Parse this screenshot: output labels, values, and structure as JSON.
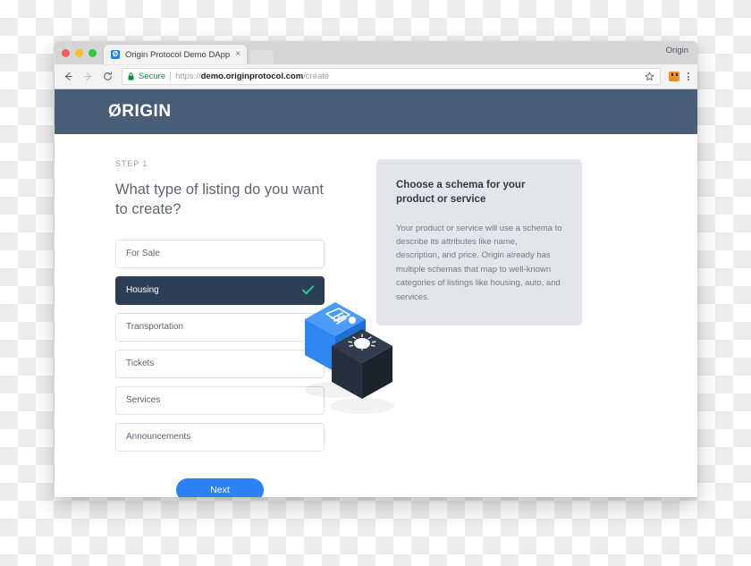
{
  "browser": {
    "traffic_lights": [
      "close",
      "minimize",
      "maximize"
    ],
    "tab": {
      "favicon_glyph": "Ø",
      "title": "Origin Protocol Demo DApp",
      "close_glyph": "×"
    },
    "profile_name": "Origin",
    "nav": {
      "back": "back-arrow",
      "forward": "forward-arrow",
      "reload": "reload-arrow"
    },
    "omnibox": {
      "lock_icon": "lock-icon",
      "secure_label": "Secure",
      "url_scheme": "https://",
      "url_host": "demo.originprotocol.com",
      "url_path": "/create",
      "star_icon": "star-icon",
      "extension_icon": "metamask-extension-icon",
      "menu_icon": "three-dot-menu-icon"
    }
  },
  "site": {
    "brand": "ØRIGIN"
  },
  "main": {
    "step_label": "STEP 1",
    "headline": "What type of listing do you want to create?",
    "options": [
      {
        "label": "For Sale",
        "selected": false
      },
      {
        "label": "Housing",
        "selected": true
      },
      {
        "label": "Transportation",
        "selected": false
      },
      {
        "label": "Tickets",
        "selected": false
      },
      {
        "label": "Services",
        "selected": false
      },
      {
        "label": "Announcements",
        "selected": false
      }
    ],
    "selected_option": "Housing",
    "next_label": "Next"
  },
  "info_panel": {
    "title": "Choose a schema for your product or service",
    "body": "Your product or service will use a schema to describe its attributes like name, description, and price. Origin already has multiple schemas that map to well-known categories of listings like housing, auto, and services."
  },
  "illustration": {
    "cube_blue_icon": "document-tag-icon",
    "cube_dark_icon": "lightbulb-icon"
  },
  "colors": {
    "header_navy": "#4a5d77",
    "selected_navy": "#2e3f55",
    "accent_blue": "#2e80f5",
    "check_green": "#26d198",
    "panel_grey": "#e2e6ea",
    "cube_blue": "#2e86f0",
    "cube_dark": "#26303d"
  }
}
